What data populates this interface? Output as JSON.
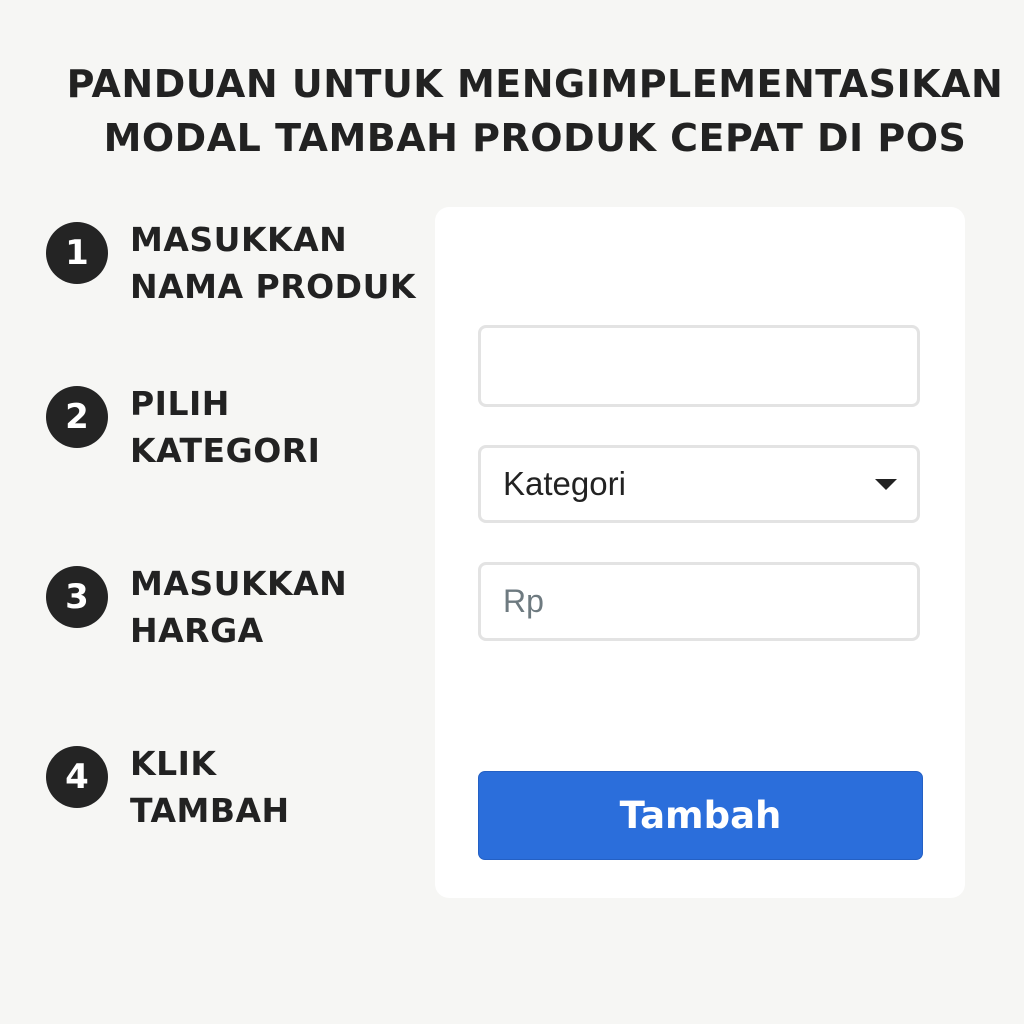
{
  "title": {
    "line1": "PANDUAN UNTUK MENGIMPLEMENTASIKAN",
    "line2": "MODAL TAMBAH PRODUK CEPAT DI POS"
  },
  "steps": [
    {
      "number": "1",
      "line1": "MASUKKAN",
      "line2": "NAMA PRODUK"
    },
    {
      "number": "2",
      "line1": "PILIH",
      "line2": "KATEGORI"
    },
    {
      "number": "3",
      "line1": "MASUKKAN",
      "line2": "HARGA"
    },
    {
      "number": "4",
      "line1": "KLIK",
      "line2": "TAMBAH"
    }
  ],
  "form": {
    "name_value": "",
    "category_value": "Kategori",
    "category_icon": "chevron-down-icon",
    "price_placeholder": "Rp",
    "submit_label": "Tambah"
  },
  "colors": {
    "background": "#f6f6f4",
    "card": "#ffffff",
    "button": "#2b6edb",
    "badge": "#242424"
  }
}
